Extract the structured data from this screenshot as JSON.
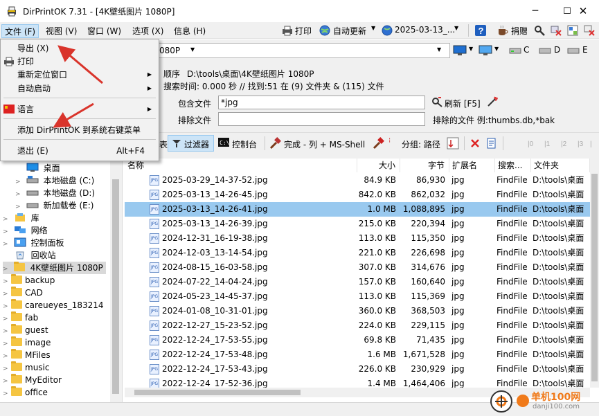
{
  "window": {
    "title": "DirPrintOK 7.31 - [4K壁纸图片 1080P]",
    "minimize": "─",
    "maximize": "☐",
    "close": "✕"
  },
  "menu": {
    "file": "文件 (F)",
    "view": "视图 (V)",
    "window": "窗口 (W)",
    "options": "选项 (X)",
    "info": "信息 (H)"
  },
  "toolbar": {
    "print": "打印",
    "autoupdate": "自动更新",
    "date_select": "2025-03-13_...",
    "donate": "捐赠"
  },
  "file_menu": {
    "export": "导出 (X)",
    "print": "打印",
    "reposition": "重新定位窗口",
    "autostart": "自动启动",
    "language": "语言",
    "add_context": "添加 DirPrintOK 到系统右键菜单",
    "exit": "退出 (E)",
    "exit_shortcut": "Alt+F4"
  },
  "path_combo": {
    "value": "080P"
  },
  "drives": [
    "C",
    "D",
    "E"
  ],
  "info": {
    "order_label": "顺序",
    "path": "D:\\tools\\桌面\\4K壁纸图片 1080P",
    "search_stats": "搜索时间: 0.000 秒 //  找到:51 在 (9) 文件夹 & (115) 文件"
  },
  "filter": {
    "include_label": "包含文件",
    "include_value": "*jpg",
    "exclude_label": "排除文件",
    "exclude_value": "",
    "refresh": "刷新 [F5]",
    "exclude_example": "排除的文件 例:thumbs.db,*bak"
  },
  "toolbar2": {
    "list_tail": "表",
    "filter": "过滤器",
    "console": "控制台",
    "finish": "完成 - 列 + MS-Shell",
    "group": "分组: 路径"
  },
  "tree": [
    {
      "label": "桌面",
      "indent": 2,
      "icon": "desktop-icon"
    },
    {
      "label": "本地磁盘 (C:)",
      "indent": 2,
      "icon": "drive-icon"
    },
    {
      "label": "本地磁盘 (D:)",
      "indent": 2,
      "icon": "drive-icon"
    },
    {
      "label": "新加载卷 (E:)",
      "indent": 2,
      "icon": "drive-icon"
    },
    {
      "label": "库",
      "indent": 1,
      "icon": "library-icon"
    },
    {
      "label": "网络",
      "indent": 1,
      "icon": "network-icon"
    },
    {
      "label": "控制面板",
      "indent": 1,
      "icon": "control-panel-icon"
    },
    {
      "label": "回收站",
      "indent": 1,
      "icon": "recycle-bin-icon"
    },
    {
      "label": "4K壁纸图片 1080P",
      "indent": 1,
      "icon": "folder-icon"
    },
    {
      "label": "backup",
      "indent": 1,
      "icon": "folder-icon"
    },
    {
      "label": "CAD",
      "indent": 1,
      "icon": "folder-icon"
    },
    {
      "label": "careueyes_183214",
      "indent": 1,
      "icon": "folder-icon"
    },
    {
      "label": "fab",
      "indent": 1,
      "icon": "folder-icon"
    },
    {
      "label": "guest",
      "indent": 1,
      "icon": "folder-icon"
    },
    {
      "label": "image",
      "indent": 1,
      "icon": "folder-icon"
    },
    {
      "label": "MFiles",
      "indent": 1,
      "icon": "folder-icon"
    },
    {
      "label": "music",
      "indent": 1,
      "icon": "folder-icon"
    },
    {
      "label": "MyEditor",
      "indent": 1,
      "icon": "folder-icon"
    },
    {
      "label": "office",
      "indent": 1,
      "icon": "folder-icon"
    }
  ],
  "table": {
    "columns": [
      "名称",
      "大小",
      "字节",
      "扩展名",
      "搜索...",
      "文件夹"
    ],
    "rows": [
      [
        "2025-03-29_14-37-52.jpg",
        "84.9 KB",
        "86,930",
        "jpg",
        "FindFile",
        "D:\\tools\\桌面"
      ],
      [
        "2025-03-13_14-26-45.jpg",
        "842.0 KB",
        "862,032",
        "jpg",
        "FindFile",
        "D:\\tools\\桌面"
      ],
      [
        "2025-03-13_14-26-41.jpg",
        "1.0 MB",
        "1,088,895",
        "jpg",
        "FindFile",
        "D:\\tools\\桌面"
      ],
      [
        "2025-03-13_14-26-39.jpg",
        "215.0 KB",
        "220,394",
        "jpg",
        "FindFile",
        "D:\\tools\\桌面"
      ],
      [
        "2024-12-31_16-19-38.jpg",
        "113.0 KB",
        "115,350",
        "jpg",
        "FindFile",
        "D:\\tools\\桌面"
      ],
      [
        "2024-12-03_13-14-54.jpg",
        "221.0 KB",
        "226,698",
        "jpg",
        "FindFile",
        "D:\\tools\\桌面"
      ],
      [
        "2024-08-15_16-03-58.jpg",
        "307.0 KB",
        "314,676",
        "jpg",
        "FindFile",
        "D:\\tools\\桌面"
      ],
      [
        "2024-07-22_14-04-24.jpg",
        "157.0 KB",
        "160,640",
        "jpg",
        "FindFile",
        "D:\\tools\\桌面"
      ],
      [
        "2024-05-23_14-45-37.jpg",
        "113.0 KB",
        "115,369",
        "jpg",
        "FindFile",
        "D:\\tools\\桌面"
      ],
      [
        "2024-01-08_10-31-01.jpg",
        "360.0 KB",
        "368,503",
        "jpg",
        "FindFile",
        "D:\\tools\\桌面"
      ],
      [
        "2022-12-27_15-23-52.jpg",
        "224.0 KB",
        "229,115",
        "jpg",
        "FindFile",
        "D:\\tools\\桌面"
      ],
      [
        "2022-12-24_17-53-55.jpg",
        "69.8 KB",
        "71,435",
        "jpg",
        "FindFile",
        "D:\\tools\\桌面"
      ],
      [
        "2022-12-24_17-53-48.jpg",
        "1.6 MB",
        "1,671,528",
        "jpg",
        "FindFile",
        "D:\\tools\\桌面"
      ],
      [
        "2022-12-24_17-53-43.jpg",
        "226.0 KB",
        "230,929",
        "jpg",
        "FindFile",
        "D:\\tools\\桌面"
      ],
      [
        "2022-12-24_17-52-36.jpg",
        "1.4 MB",
        "1,464,406",
        "jpg",
        "FindFile",
        "D:\\tools\\桌面"
      ]
    ],
    "selected_index": 2
  },
  "watermark": {
    "line1": "单机100网",
    "line2": "danji100.com"
  },
  "colors": {
    "selection": "#99c9ef",
    "menu_highlight": "#cce4f7",
    "annotation_arrow": "#d9342b"
  }
}
